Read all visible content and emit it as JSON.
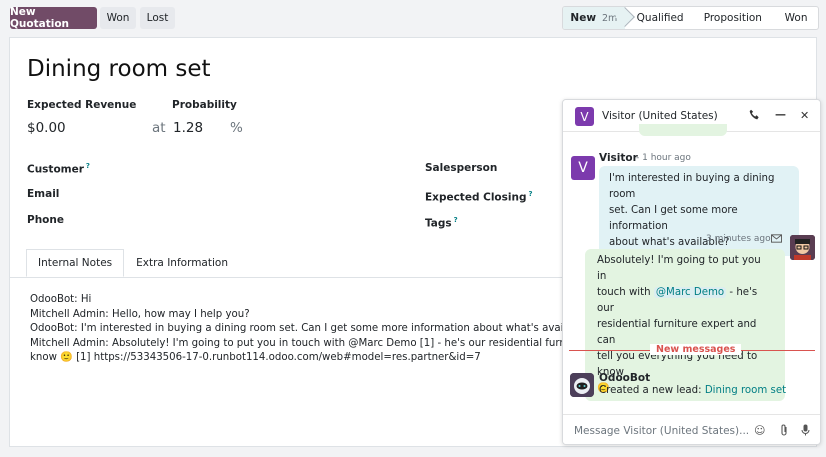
{
  "toolbar": {
    "new_quotation": "New Quotation",
    "won": "Won",
    "lost": "Lost"
  },
  "stages": [
    {
      "label": "New",
      "duration": "2m",
      "active": true
    },
    {
      "label": "Qualified",
      "active": false
    },
    {
      "label": "Proposition",
      "active": false
    },
    {
      "label": "Won",
      "active": false
    }
  ],
  "form": {
    "title": "Dining room set",
    "expected_revenue_label": "Expected Revenue",
    "expected_revenue": "$0.00",
    "probability_label": "Probability",
    "at": "at",
    "probability": "1.28",
    "percent": "%",
    "customer_label": "Customer",
    "email_label": "Email",
    "phone_label": "Phone",
    "salesperson_label": "Salesperson",
    "expected_closing_label": "Expected Closing",
    "tags_label": "Tags",
    "help_mark": "?"
  },
  "tabs": [
    {
      "label": "Internal Notes",
      "active": true
    },
    {
      "label": "Extra Information",
      "active": false
    }
  ],
  "notes": [
    "OdooBot: Hi",
    "Mitchell Admin: Hello, how may I help you?",
    "OdooBot: I'm interested in buying a dining room set. Can I get some more information about what's available?",
    "Mitchell Admin: Absolutely! I'm going to put you in touch with @Marc Demo [1] - he's our residential furniture expert",
    "know 🙂 [1] https://53343506-17-0.runbot114.odoo.com/web#model=res.partner&id=7"
  ],
  "chat": {
    "avatar_letter": "V",
    "title": "Visitor (United States)",
    "visitor_name": "Visitor",
    "visitor_time": "- 1 hour ago",
    "visitor_message": [
      "I'm interested in buying a dining room",
      "set. Can I get some more information",
      "about what's available?"
    ],
    "admin_time": "3 minutes ago",
    "admin_line1": "Absolutely! I'm going to put you in",
    "admin_line2_pre": "touch with",
    "admin_mention": "@Marc Demo",
    "admin_line2_post": "- he's our",
    "admin_line3": "residential furniture expert and can",
    "admin_line4": "tell you everything you need to know",
    "admin_emoji": "🙂",
    "new_messages": "New messages",
    "bot_name": "OdooBot",
    "bot_text": "Created a new lead:",
    "bot_link": "Dining room set",
    "placeholder": "Message Visitor (United States)..."
  },
  "icons": {
    "phone": "phone-icon",
    "minimize": "minimize-icon",
    "close": "close-icon",
    "envelope": "envelope-icon",
    "emoji": "emoji-icon",
    "attach": "paperclip-icon",
    "mic": "microphone-icon"
  },
  "colors": {
    "primary": "#714B67",
    "accent": "#017e84",
    "visitor_avatar": "#7C3AAD",
    "new_messages": "#d9534f"
  }
}
